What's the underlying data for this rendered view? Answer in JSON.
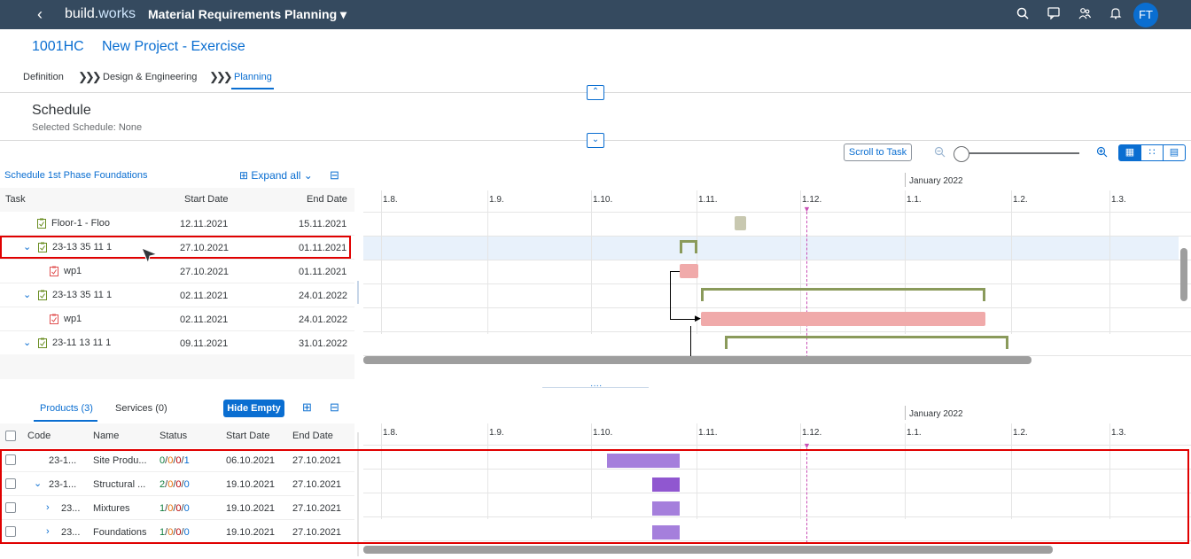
{
  "shell": {
    "brand_main": "build.",
    "brand_sub": "works",
    "app_title": "Material Requirements Planning",
    "avatar_initials": "FT",
    "icons": [
      "search-icon",
      "feedback-icon",
      "people-icon",
      "bell-icon"
    ]
  },
  "object": {
    "id": "1001HC",
    "name": "New Project - Exercise"
  },
  "steps": [
    {
      "label": "Definition",
      "active": false
    },
    {
      "label": "Design & Engineering",
      "active": false
    },
    {
      "label": "Planning",
      "active": true
    }
  ],
  "schedule": {
    "title": "Schedule",
    "selected": "Selected Schedule: None"
  },
  "toolbar": {
    "scroll_to_task": "Scroll to Task"
  },
  "task_table": {
    "schedule_name": "Schedule 1st Phase Foundations",
    "expand_all": "Expand all",
    "headers": {
      "task": "Task",
      "start": "Start Date",
      "end": "End Date"
    },
    "rows": [
      {
        "name": "Floor-1 - Floo",
        "start": "12.11.2021",
        "end": "15.11.2021",
        "indent": 1,
        "expandable": false,
        "icon": "green"
      },
      {
        "name": "23-13 35 11 1",
        "start": "27.10.2021",
        "end": "01.11.2021",
        "indent": 0,
        "expandable": true,
        "icon": "green"
      },
      {
        "name": "wp1",
        "start": "27.10.2021",
        "end": "01.11.2021",
        "indent": 2,
        "expandable": false,
        "icon": "red"
      },
      {
        "name": "23-13 35 11 1",
        "start": "02.11.2021",
        "end": "24.01.2022",
        "indent": 0,
        "expandable": true,
        "icon": "green"
      },
      {
        "name": "wp1",
        "start": "02.11.2021",
        "end": "24.01.2022",
        "indent": 2,
        "expandable": false,
        "icon": "red"
      },
      {
        "name": "23-11 13 11 1",
        "start": "09.11.2021",
        "end": "31.01.2022",
        "indent": 0,
        "expandable": true,
        "icon": "green"
      }
    ]
  },
  "gantt": {
    "month_label": "January 2022",
    "ticks": [
      "1.8.",
      "1.9.",
      "1.10.",
      "1.11.",
      "1.12.",
      "1.1.",
      "1.2.",
      "1.3."
    ]
  },
  "products": {
    "tabs": [
      {
        "label": "Products (3)",
        "active": true
      },
      {
        "label": "Services (0)",
        "active": false
      }
    ],
    "hide_empty": "Hide Empty",
    "headers": {
      "code": "Code",
      "name": "Name",
      "status": "Status",
      "start": "Start Date",
      "end": "End Date"
    },
    "rows": [
      {
        "code": "23-1...",
        "name": "Site Produ...",
        "s1": "0",
        "s2": "0",
        "s3": "0",
        "s4": "1",
        "start": "06.10.2021",
        "end": "27.10.2021",
        "chev": ""
      },
      {
        "code": "23-1...",
        "name": "Structural ...",
        "s1": "2",
        "s2": "0",
        "s3": "0",
        "s4": "0",
        "start": "19.10.2021",
        "end": "27.10.2021",
        "chev": "down"
      },
      {
        "code": "23...",
        "name": "Mixtures",
        "s1": "1",
        "s2": "0",
        "s3": "0",
        "s4": "0",
        "start": "19.10.2021",
        "end": "27.10.2021",
        "chev": "right"
      },
      {
        "code": "23...",
        "name": "Foundations",
        "s1": "1",
        "s2": "0",
        "s3": "0",
        "s4": "0",
        "start": "19.10.2021",
        "end": "27.10.2021",
        "chev": "right"
      }
    ]
  },
  "colors": {
    "shell": "#354a5f",
    "accent": "#0a6ed1",
    "summary_bar": "#8a9a5b",
    "task_bar": "#f0aaaa",
    "product_bar": "#a57fdc",
    "today_line": "#c94fb5",
    "highlight": "#e00000"
  }
}
